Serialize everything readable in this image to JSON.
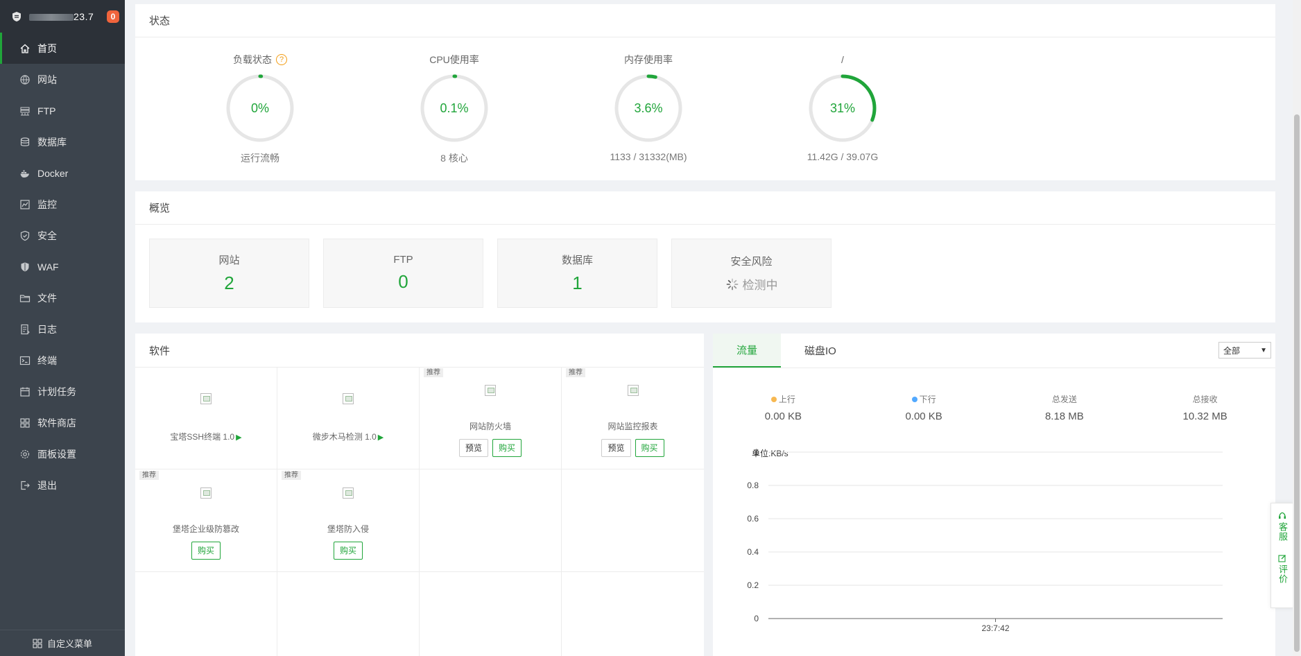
{
  "sidebar": {
    "host_suffix": "23.7",
    "badge": "0",
    "items": [
      {
        "label": "首页",
        "icon": "home-icon"
      },
      {
        "label": "网站",
        "icon": "globe-icon"
      },
      {
        "label": "FTP",
        "icon": "ftp-icon"
      },
      {
        "label": "数据库",
        "icon": "database-icon"
      },
      {
        "label": "Docker",
        "icon": "docker-icon"
      },
      {
        "label": "监控",
        "icon": "monitor-icon"
      },
      {
        "label": "安全",
        "icon": "shield-icon"
      },
      {
        "label": "WAF",
        "icon": "waf-shield-icon"
      },
      {
        "label": "文件",
        "icon": "folder-icon"
      },
      {
        "label": "日志",
        "icon": "log-icon"
      },
      {
        "label": "终端",
        "icon": "terminal-icon"
      },
      {
        "label": "计划任务",
        "icon": "calendar-icon"
      },
      {
        "label": "软件商店",
        "icon": "apps-icon"
      },
      {
        "label": "面板设置",
        "icon": "gear-icon"
      },
      {
        "label": "退出",
        "icon": "logout-icon"
      }
    ],
    "footer": "自定义菜单"
  },
  "status": {
    "title": "状态",
    "gauges": [
      {
        "title": "负载状态",
        "value": "0%",
        "percent": 0,
        "sub": "运行流畅",
        "help": "?"
      },
      {
        "title": "CPU使用率",
        "value": "0.1%",
        "percent": 0.1,
        "sub": "8 核心"
      },
      {
        "title": "内存使用率",
        "value": "3.6%",
        "percent": 3.6,
        "sub": "1133 / 31332(MB)"
      },
      {
        "title": "/",
        "value": "31%",
        "percent": 31,
        "sub": "11.42G / 39.07G"
      }
    ],
    "accent": "#20a53a"
  },
  "overview": {
    "title": "概览",
    "cards": [
      {
        "label": "网站",
        "value": "2"
      },
      {
        "label": "FTP",
        "value": "0"
      },
      {
        "label": "数据库",
        "value": "1"
      },
      {
        "label": "安全风险",
        "value": "检测中"
      }
    ]
  },
  "software": {
    "title": "软件",
    "tag": "推荐",
    "preview_label": "预览",
    "buy_label": "购买",
    "items": [
      {
        "name": "宝塔SSH终端 1.0",
        "type": "installed"
      },
      {
        "name": "微步木马检测 1.0",
        "type": "installed"
      },
      {
        "name": "网站防火墙",
        "type": "preview_buy"
      },
      {
        "name": "网站监控报表",
        "type": "preview_buy"
      },
      {
        "name": "堡塔企业级防篡改",
        "type": "buy"
      },
      {
        "name": "堡塔防入侵",
        "type": "buy"
      }
    ]
  },
  "traffic": {
    "tabs": [
      "流量",
      "磁盘IO"
    ],
    "select_value": "全部",
    "stats": [
      {
        "label": "上行",
        "value": "0.00 KB",
        "dot": "#f7b851"
      },
      {
        "label": "下行",
        "value": "0.00 KB",
        "dot": "#52a9ff"
      },
      {
        "label": "总发送",
        "value": "8.18 MB"
      },
      {
        "label": "总接收",
        "value": "10.32 MB"
      }
    ],
    "unit": "单位:KB/s",
    "chart_data": {
      "type": "line",
      "x": [
        "23:7:42"
      ],
      "yticks": [
        "0",
        "0.2",
        "0.4",
        "0.6",
        "0.8",
        "1"
      ],
      "ylim": [
        0,
        1
      ],
      "grid": true
    }
  },
  "float_service": [
    {
      "label": "客服",
      "icon": "headset-icon"
    },
    {
      "label": "评价",
      "icon": "edit-icon"
    }
  ]
}
